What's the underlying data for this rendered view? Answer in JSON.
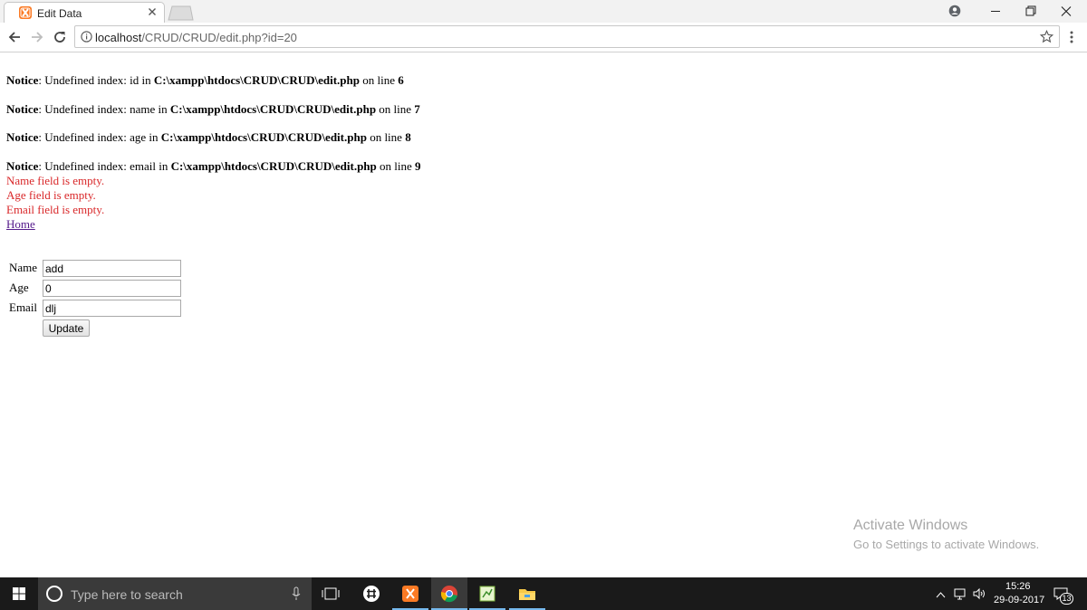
{
  "browser": {
    "tab_title": "Edit Data",
    "url_host": "localhost",
    "url_path": "/CRUD/CRUD/edit.php?id=20"
  },
  "notices": [
    {
      "label": "Notice",
      "text1": ": Undefined index: id in ",
      "file": "C:\\xampp\\htdocs\\CRUD\\CRUD\\edit.php",
      "text2": " on line ",
      "line": "6"
    },
    {
      "label": "Notice",
      "text1": ": Undefined index: name in ",
      "file": "C:\\xampp\\htdocs\\CRUD\\CRUD\\edit.php",
      "text2": " on line ",
      "line": "7"
    },
    {
      "label": "Notice",
      "text1": ": Undefined index: age in ",
      "file": "C:\\xampp\\htdocs\\CRUD\\CRUD\\edit.php",
      "text2": " on line ",
      "line": "8"
    },
    {
      "label": "Notice",
      "text1": ": Undefined index: email in ",
      "file": "C:\\xampp\\htdocs\\CRUD\\CRUD\\edit.php",
      "text2": " on line ",
      "line": "9"
    }
  ],
  "errors": [
    "Name field is empty.",
    "Age field is empty.",
    "Email field is empty."
  ],
  "home_link": "Home",
  "form": {
    "name_label": "Name",
    "name_value": "add",
    "age_label": "Age",
    "age_value": "0",
    "email_label": "Email",
    "email_value": "dlj",
    "submit_label": "Update"
  },
  "watermark": {
    "title": "Activate Windows",
    "subtitle": "Go to Settings to activate Windows."
  },
  "taskbar": {
    "search_placeholder": "Type here to search",
    "time": "15:26",
    "date": "29-09-2017",
    "notification_count": "13"
  },
  "colors": {
    "error_red": "#d9282a",
    "link_visited": "#551a8b",
    "taskbar_bg": "#1a1a1a",
    "xampp_orange": "#fb7a24"
  }
}
